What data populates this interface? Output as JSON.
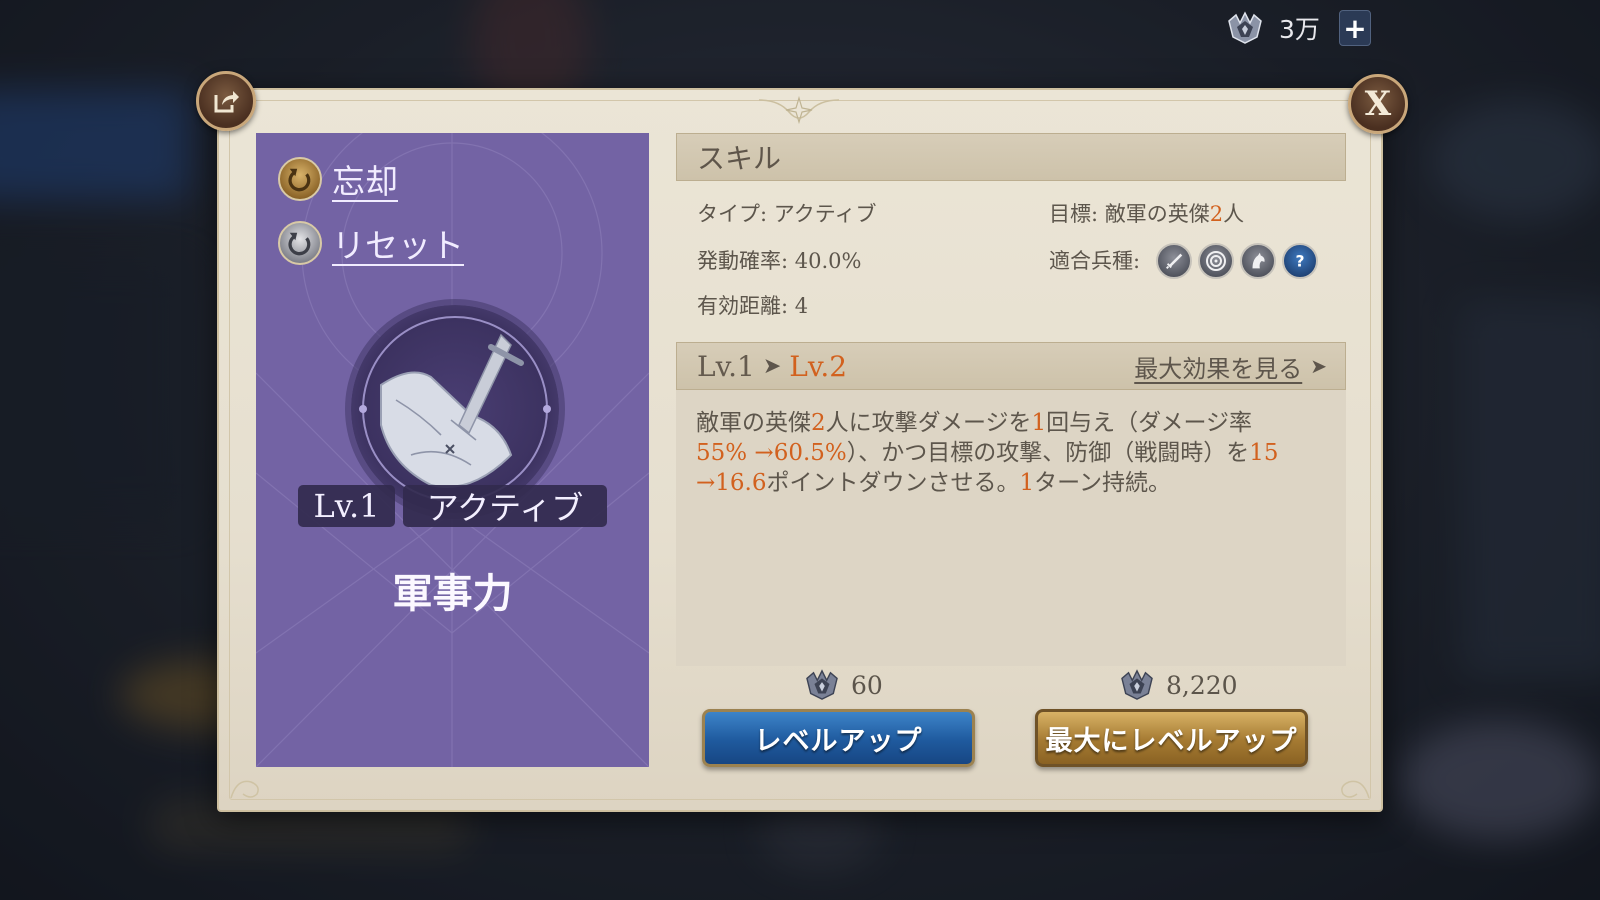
{
  "currency": {
    "amount": "3万",
    "plus_label": "+",
    "icon": "gem-crown-icon"
  },
  "dialog": {
    "close_label": "X",
    "share_icon": "share-icon"
  },
  "skill_card": {
    "forget_label": "忘却",
    "reset_label": "リセット",
    "level_tag": "Lv.1",
    "type_tag": "アクティブ",
    "name": "軍事力",
    "panel_color": "#7363a4"
  },
  "skill_section": {
    "title": "スキル",
    "type_label": "タイプ: ",
    "type_value": "アクティブ",
    "target_label": "目標: ",
    "target_value_a": "敵軍の英傑",
    "target_value_num": "2",
    "target_value_b": "人",
    "rate_label": "発動確率: ",
    "rate_value": "40.0%",
    "range_label": "有効距離: ",
    "range_value": "4",
    "troop_label": "適合兵種:",
    "troop_icons": [
      "sword-icon",
      "target-icon",
      "horse-icon",
      "question-icon"
    ]
  },
  "level_section": {
    "current": "Lv.1",
    "arrow": "➤",
    "next": "Lv.2",
    "max_effect_label": "最大効果を見る",
    "max_effect_arrow": "➤"
  },
  "description": {
    "l1_a": "敵軍の英傑",
    "l1_b": "2",
    "l1_c": "人に攻撃ダメージを",
    "l1_d": "1",
    "l1_e": "回与え（ダメージ率",
    "l2_a": "55% →60.5%",
    "l2_b": "）、かつ目標の攻撃、防御（戦闘時）を",
    "l2_c": "15",
    "l3_a": "→16.6",
    "l3_b": "ポイントダウンさせる。",
    "l3_c": "1",
    "l3_d": "ターン持続。"
  },
  "actions": {
    "levelup_cost": "60",
    "levelup_label": "レベルアップ",
    "max_cost": "8,220",
    "max_label": "最大にレベルアップ"
  },
  "colors": {
    "highlight": "#d2611e",
    "levelup_button": "#1f5a9e",
    "max_button": "#a57a32"
  }
}
